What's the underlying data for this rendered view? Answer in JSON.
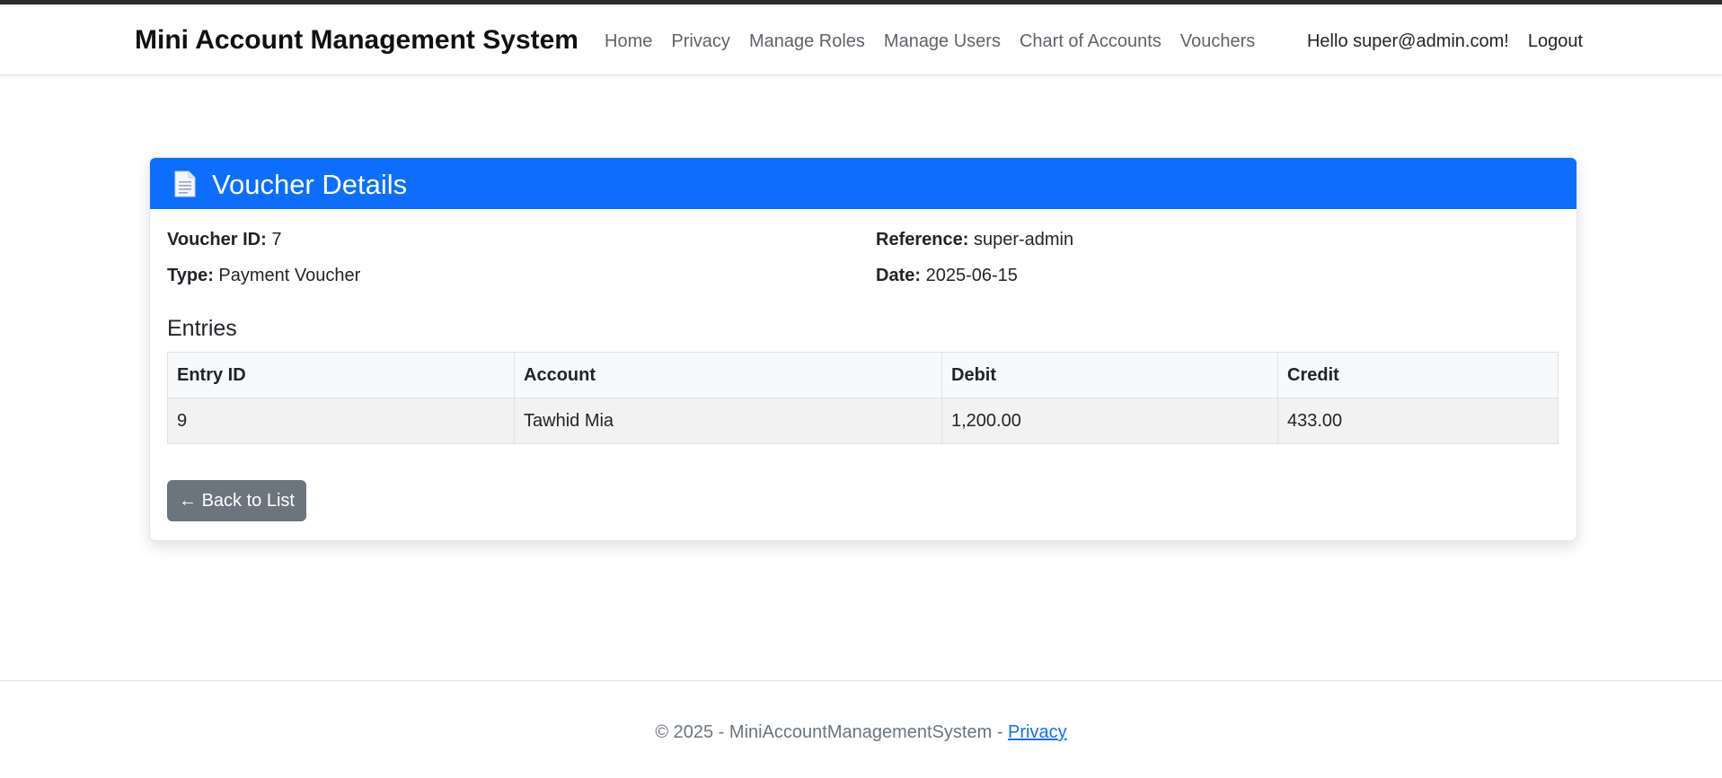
{
  "app": {
    "brand": "Mini Account Management System"
  },
  "nav": {
    "items": [
      {
        "label": "Home"
      },
      {
        "label": "Privacy"
      },
      {
        "label": "Manage Roles"
      },
      {
        "label": "Manage Users"
      },
      {
        "label": "Chart of Accounts"
      },
      {
        "label": "Vouchers"
      }
    ],
    "greeting": "Hello super@admin.com!",
    "logout": "Logout"
  },
  "card": {
    "icon": "document-icon",
    "title": "Voucher Details",
    "fields": {
      "voucher_id_label": "Voucher ID:",
      "voucher_id_value": "7",
      "type_label": "Type:",
      "type_value": "Payment Voucher",
      "reference_label": "Reference:",
      "reference_value": "super-admin",
      "date_label": "Date:",
      "date_value": "2025-06-15"
    },
    "entries_heading": "Entries",
    "table": {
      "headers": [
        "Entry ID",
        "Account",
        "Debit",
        "Credit"
      ],
      "rows": [
        [
          "9",
          "Tawhid Mia",
          "1,200.00",
          "433.00"
        ]
      ]
    },
    "back_button": "← Back to List"
  },
  "footer": {
    "text": "© 2025 - MiniAccountManagementSystem - ",
    "link": "Privacy"
  },
  "colors": {
    "header_blue": "#0d6efd",
    "button_gray": "#6c757d"
  }
}
